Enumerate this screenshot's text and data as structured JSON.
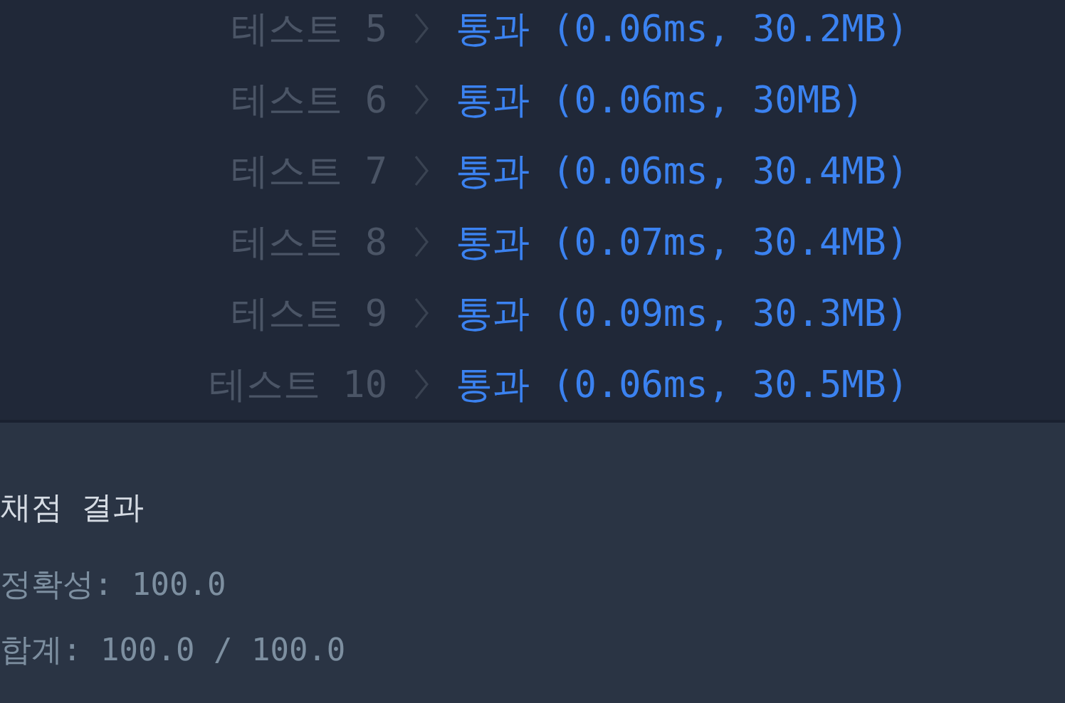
{
  "tests": [
    {
      "label": "테스트 5",
      "result": "통과 (0.06ms, 30.2MB)"
    },
    {
      "label": "테스트 6",
      "result": "통과 (0.06ms, 30MB)"
    },
    {
      "label": "테스트 7",
      "result": "통과 (0.06ms, 30.4MB)"
    },
    {
      "label": "테스트 8",
      "result": "통과 (0.07ms, 30.4MB)"
    },
    {
      "label": "테스트 9",
      "result": "통과 (0.09ms, 30.3MB)"
    },
    {
      "label": "테스트 10",
      "result": "통과 (0.06ms, 30.5MB)"
    }
  ],
  "summary": {
    "title": "채점 결과",
    "lines": [
      "정확성: 100.0",
      "합계: 100.0 / 100.0"
    ]
  }
}
